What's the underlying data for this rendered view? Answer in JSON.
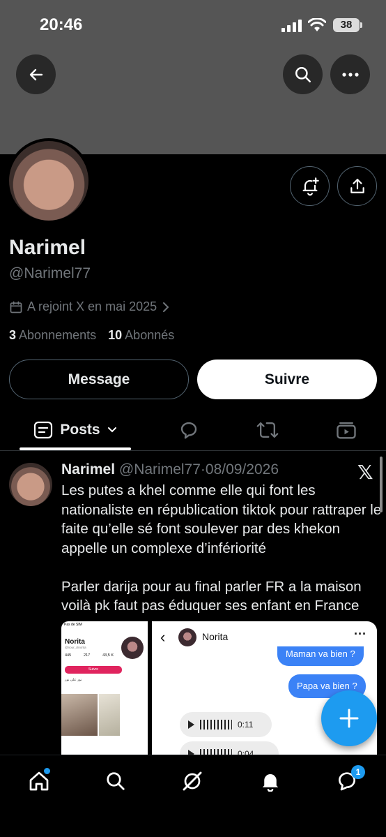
{
  "status_bar": {
    "time": "20:46",
    "battery": "38"
  },
  "icons": {
    "back": "back-arrow-icon",
    "search": "search-icon",
    "more": "more-horizontal-icon",
    "notify": "bell-plus-icon",
    "share": "share-icon",
    "calendar": "calendar-icon",
    "chevron": "chevron-right-icon"
  },
  "profile": {
    "display_name": "Narimel",
    "handle": "@Narimel77",
    "joined": "A rejoint X en mai 2025",
    "following_count": "3",
    "following_label": "Abonnements",
    "followers_count": "10",
    "followers_label": "Abonnés"
  },
  "actions": {
    "message_label": "Message",
    "follow_label": "Suivre"
  },
  "tabs": {
    "posts_label": "Posts"
  },
  "post": {
    "author": "Narimel",
    "handle": "@Narimel77",
    "date": "08/09/2026",
    "separator": "·",
    "text": "Les putes a khel comme elle qui font les nationaliste en républication tiktok pour rattraper le faite qu’elle sé font soulever par des khekon appelle un complexe d’infériorité\n\nParler darija pour au final parler FR  a la maison voilà pk faut pas éduquer ses enfant en France",
    "media1": {
      "status": "Pas de SIM",
      "name": "Norita",
      "handle": "@nour_xlnorita",
      "stats": [
        "445",
        "217",
        "43,5 K"
      ],
      "follow": "Suivre",
      "arabic": "نور على نور"
    },
    "media2": {
      "contact": "Norita",
      "bubble1": "Maman va bien ?",
      "bubble2": "Papa va bien ?",
      "voice1_time": "0:11",
      "voice2_time": "0:04"
    }
  },
  "nav": {
    "messages_badge": "1"
  },
  "colors": {
    "accent": "#1d9bf0",
    "banner": "#555555",
    "background": "#000000"
  }
}
